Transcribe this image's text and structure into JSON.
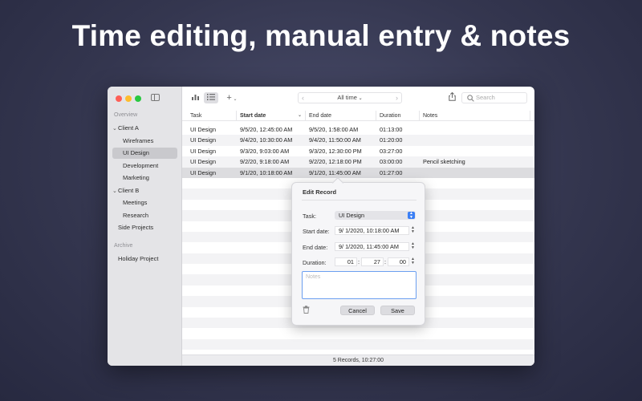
{
  "headline": "Time editing, manual entry & notes",
  "sidebar": {
    "overview_label": "Overview",
    "archive_label": "Archive",
    "items": [
      {
        "label": "Client A",
        "kind": "group"
      },
      {
        "label": "Wireframes",
        "kind": "child"
      },
      {
        "label": "UI Design",
        "kind": "child",
        "selected": true
      },
      {
        "label": "Development",
        "kind": "child"
      },
      {
        "label": "Marketing",
        "kind": "child"
      },
      {
        "label": "Client B",
        "kind": "group"
      },
      {
        "label": "Meetings",
        "kind": "child"
      },
      {
        "label": "Research",
        "kind": "child"
      },
      {
        "label": "Side Projects",
        "kind": "top"
      }
    ],
    "archive_items": [
      {
        "label": "Holiday Project"
      }
    ]
  },
  "toolbar": {
    "chart_icon": "bar-chart-icon",
    "list_icon": "list-icon",
    "add_icon": "plus-icon",
    "period_label": "All time",
    "search_placeholder": "Search"
  },
  "table": {
    "columns": [
      "Task",
      "Start date",
      "End date",
      "Duration",
      "Notes"
    ],
    "rows": [
      {
        "task": "UI Design",
        "start": "9/5/20, 12:45:00 AM",
        "end": "9/5/20, 1:58:00 AM",
        "duration": "01:13:00",
        "notes": ""
      },
      {
        "task": "UI Design",
        "start": "9/4/20, 10:30:00 AM",
        "end": "9/4/20, 11:50:00 AM",
        "duration": "01:20:00",
        "notes": ""
      },
      {
        "task": "UI Design",
        "start": "9/3/20, 9:03:00 AM",
        "end": "9/3/20, 12:30:00 PM",
        "duration": "03:27:00",
        "notes": ""
      },
      {
        "task": "UI Design",
        "start": "9/2/20, 9:18:00 AM",
        "end": "9/2/20, 12:18:00 PM",
        "duration": "03:00:00",
        "notes": "Pencil sketching"
      },
      {
        "task": "UI Design",
        "start": "9/1/20, 10:18:00 AM",
        "end": "9/1/20, 11:45:00 AM",
        "duration": "01:27:00",
        "notes": "",
        "selected": true
      }
    ]
  },
  "footer": {
    "summary": "5 Records, 10:27:00"
  },
  "edit_record": {
    "title": "Edit Record",
    "task_label": "Task:",
    "task_value": "UI Design",
    "start_label": "Start date:",
    "start_value": "9/  1/2020, 10:18:00 AM",
    "end_label": "End date:",
    "end_value": "9/  1/2020, 11:45:00 AM",
    "duration_label": "Duration:",
    "duration_hours": "01",
    "duration_minutes": "27",
    "duration_seconds": "00",
    "notes_placeholder": "Notes",
    "cancel_label": "Cancel",
    "save_label": "Save"
  }
}
